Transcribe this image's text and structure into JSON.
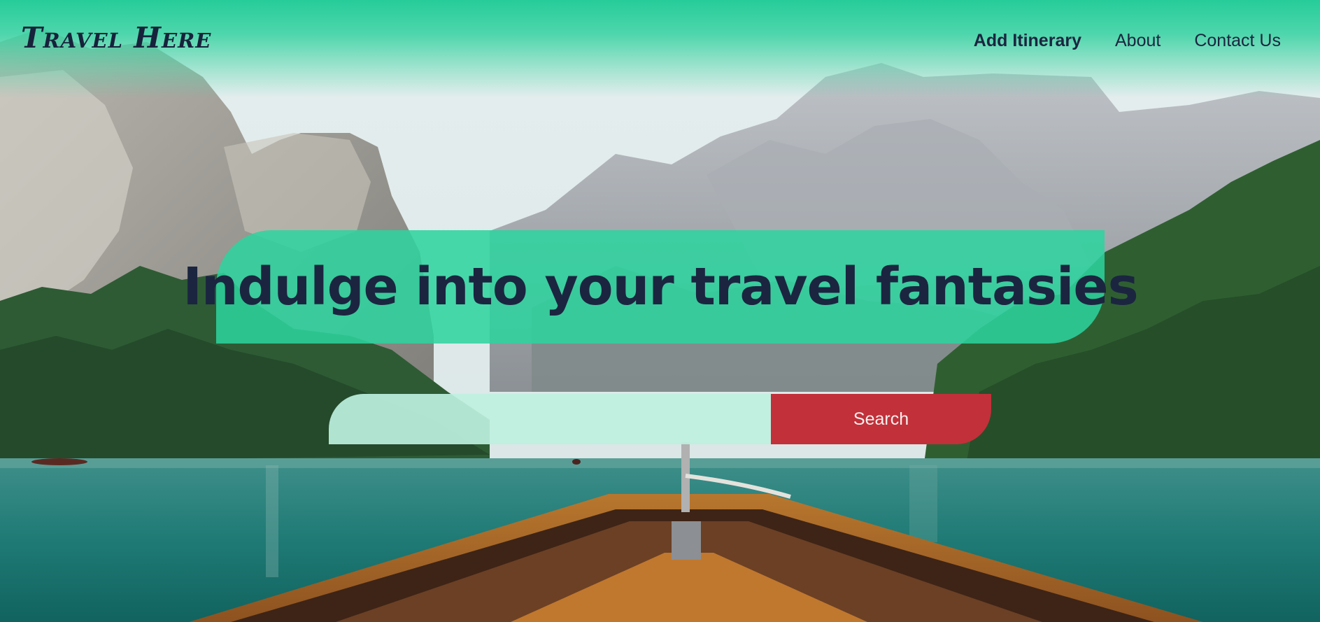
{
  "header": {
    "logo": "Travel Here",
    "nav": [
      {
        "label": "Add Itinerary"
      },
      {
        "label": "About"
      },
      {
        "label": "Contact Us"
      }
    ]
  },
  "hero": {
    "title": "Indulge into your travel fantasies",
    "search": {
      "placeholder": "",
      "value": "",
      "button_label": "Search"
    }
  },
  "colors": {
    "accent_green": "#2ccf9b",
    "search_red": "#c2303a",
    "text_navy": "#1b2540"
  },
  "background": {
    "icon": "lake-mountains-boat-photo"
  }
}
